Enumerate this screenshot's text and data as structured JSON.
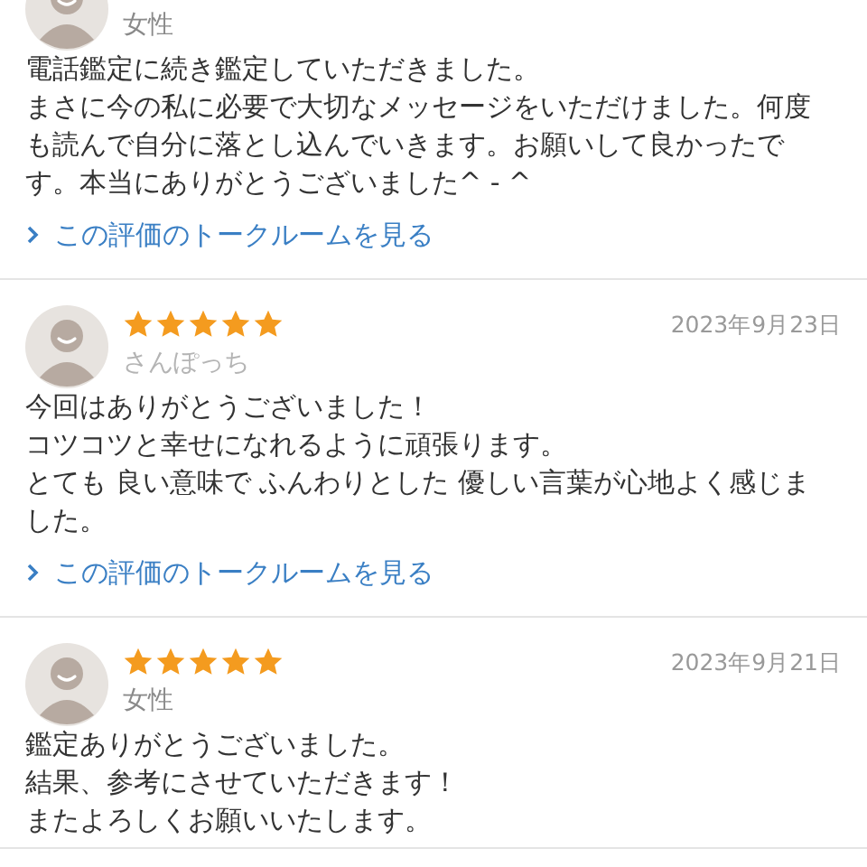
{
  "reviews": [
    {
      "name": "女性",
      "name_faded": false,
      "body": [
        "電話鑑定に続き鑑定していただきました。",
        "まさに今の私に必要で大切なメッセージをいただけました。何度も読んで自分に落とし込んでいきます。お願いして良かったです。本当にありがとうございました^ - ^"
      ],
      "link": "この評価のトークルームを見る"
    },
    {
      "stars": 5,
      "date": "2023年9月23日",
      "name": "さんぽっち",
      "name_faded": true,
      "body": [
        "今回はありがとうございました！",
        "コツコツと幸せになれるように頑張ります。",
        "とても 良い意味で ふんわりとした 優しい言葉が心地よく感じました。"
      ],
      "link": "この評価のトークルームを見る"
    },
    {
      "stars": 5,
      "date": "2023年9月21日",
      "name": "女性",
      "name_faded": false,
      "body": [
        "鑑定ありがとうございました。",
        "結果、参考にさせていただきます！",
        "またよろしくお願いいたします。"
      ]
    }
  ]
}
